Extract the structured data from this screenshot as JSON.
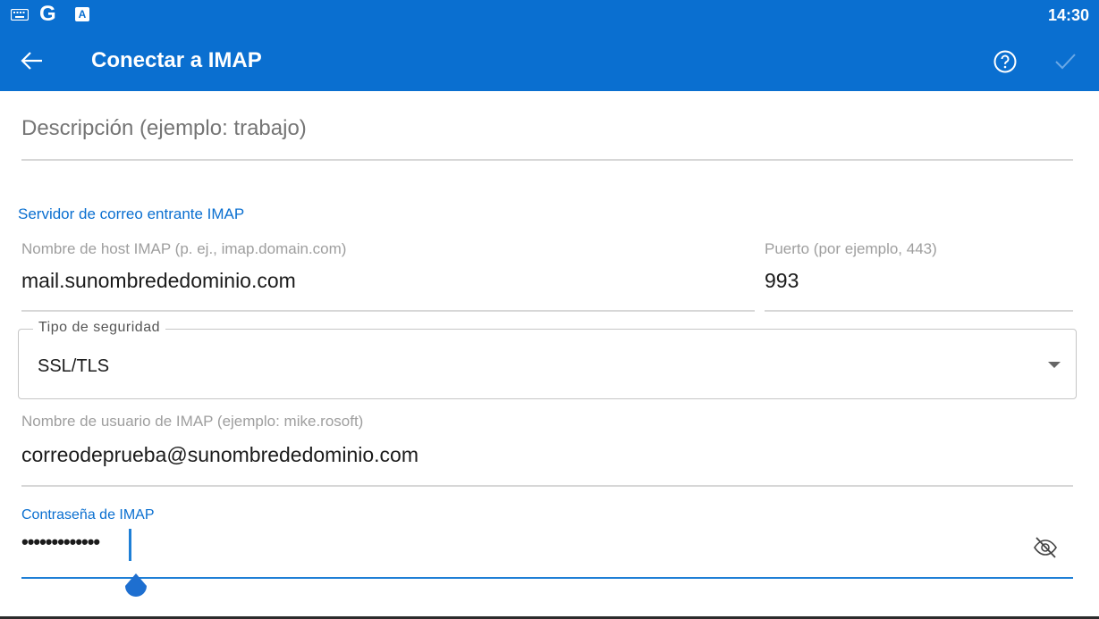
{
  "status_bar": {
    "time": "14:30",
    "icons": [
      "keyboard-icon",
      "google-g-icon",
      "translate-a-icon"
    ],
    "g_glyph": "G",
    "a_glyph": "A"
  },
  "app_bar": {
    "title": "Conectar a IMAP",
    "icons": [
      "back-arrow-icon",
      "help-icon",
      "check-icon"
    ],
    "background": "#0a6fd0"
  },
  "form": {
    "description": {
      "placeholder": "Descripción (ejemplo: trabajo)",
      "value": ""
    },
    "incoming_section_title": "Servidor de correo entrante IMAP",
    "host": {
      "label": "Nombre de host IMAP (p. ej., imap.domain.com)",
      "value": "mail.sunombrededominio.com"
    },
    "port": {
      "label": "Puerto (por ejemplo, 443)",
      "value": "993"
    },
    "security": {
      "label": "Tipo de seguridad",
      "value": "SSL/TLS"
    },
    "username": {
      "label": "Nombre de usuario de IMAP (ejemplo: mike.rosoft)",
      "value": "correodeprueba@sunombrededominio.com"
    },
    "password": {
      "label": "Contraseña de IMAP",
      "masked_value": "•••••••••••••",
      "visibility_icon": "eye-off-icon"
    }
  },
  "colors": {
    "accent": "#0a6fd0",
    "focus_line": "#1e7fd6",
    "label_gray": "#9e9e9e"
  }
}
